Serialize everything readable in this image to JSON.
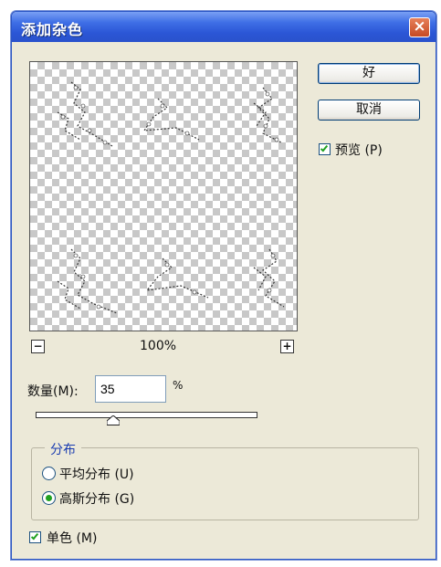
{
  "window": {
    "title": "添加杂色",
    "close_glyph": "×"
  },
  "preview": {
    "zoom_out_glyph": "−",
    "zoom_in_glyph": "+",
    "zoom_level": "100%"
  },
  "buttons": {
    "ok_label": "好",
    "cancel_label": "取消"
  },
  "preview_toggle": {
    "label": "预览 (P)",
    "checked": true
  },
  "amount": {
    "label": "数量(M):",
    "value": "35",
    "unit": "%",
    "slider_fraction": 0.35
  },
  "distribution": {
    "title": "分布",
    "options": [
      {
        "label": "平均分布 (U)",
        "selected": false
      },
      {
        "label": "高斯分布 (G)",
        "selected": true
      }
    ]
  },
  "monochrome": {
    "label": "单色 (M)",
    "checked": true
  },
  "colors": {
    "titlebar": "#2b56d6",
    "dialog_bg": "#ece9d8",
    "check_green": "#21a121"
  }
}
